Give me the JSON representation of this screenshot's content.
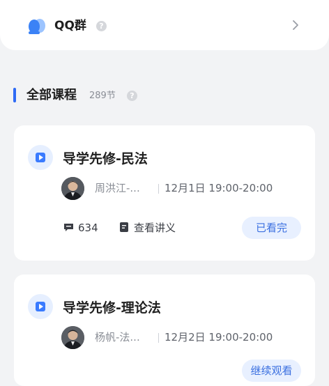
{
  "qq_group": {
    "label": "QQ群",
    "help_glyph": "?",
    "chevron_icon": "chevron-right-icon"
  },
  "section": {
    "title": "全部课程",
    "count": "289节",
    "help_glyph": "?",
    "accent": "#2f6bf5"
  },
  "courses": [
    {
      "title": "导学先修-民法",
      "teacher": "周洪江-...",
      "time": "12月1日 19:00-20:00",
      "comment_count": "634",
      "notes_label": "查看讲义",
      "status_label": "已看完"
    },
    {
      "title": "导学先修-理论法",
      "teacher": "杨帆-法...",
      "time": "12月2日 19:00-20:00",
      "status_label": "继续观看"
    }
  ],
  "colors": {
    "page_bg": "#f2f3f5",
    "card_bg": "#ffffff",
    "status_bg": "#e8f0ff",
    "status_text": "#3a6fe0"
  }
}
